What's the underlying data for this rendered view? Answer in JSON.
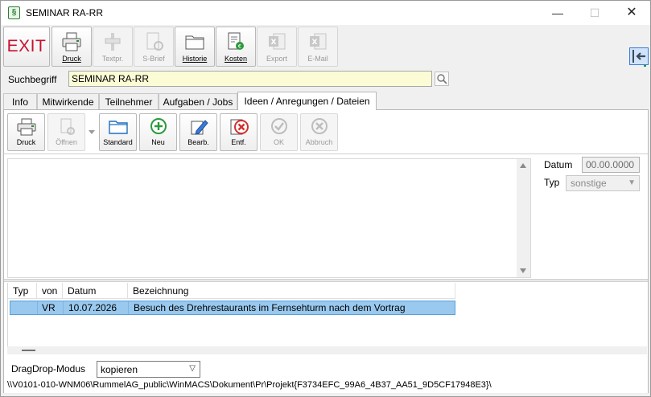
{
  "window": {
    "title": "SEMINAR RA-RR",
    "minimize": "—",
    "maximize": "☐",
    "close": "✕"
  },
  "toolbar": {
    "exit_label": "EXIT",
    "buttons": [
      {
        "label": "Druck",
        "icon": "printer-icon",
        "enabled": true
      },
      {
        "label": "Textpr.",
        "icon": "text-processing-icon",
        "enabled": false
      },
      {
        "label": "S-Brief",
        "icon": "serial-letter-icon",
        "enabled": false
      },
      {
        "label": "Historie",
        "icon": "folder-icon",
        "enabled": true
      },
      {
        "label": "Kosten",
        "icon": "costs-icon",
        "enabled": true
      },
      {
        "label": "Export",
        "icon": "excel-icon",
        "enabled": false
      },
      {
        "label": "E-Mail",
        "icon": "excel-mail-icon",
        "enabled": false
      }
    ]
  },
  "search": {
    "label": "Suchbegriff",
    "value": "SEMINAR RA-RR"
  },
  "tabs": [
    {
      "label": "Info",
      "active": false
    },
    {
      "label": "Mitwirkende",
      "active": false
    },
    {
      "label": "Teilnehmer",
      "active": false
    },
    {
      "label": "Aufgaben / Jobs",
      "active": false
    },
    {
      "label": "Ideen / Anregungen / Dateien",
      "active": true
    }
  ],
  "panel_toolbar": {
    "buttons": [
      {
        "label": "Druck",
        "enabled": true
      },
      {
        "label": "Öffnen",
        "enabled": false
      },
      {
        "label": "Standard",
        "enabled": true
      },
      {
        "label": "Neu",
        "enabled": true
      },
      {
        "label": "Bearb.",
        "enabled": true
      },
      {
        "label": "Entf.",
        "enabled": true
      },
      {
        "label": "OK",
        "enabled": false
      },
      {
        "label": "Abbruch",
        "enabled": false
      }
    ]
  },
  "detail": {
    "datum_label": "Datum",
    "datum_value": "00.00.0000",
    "typ_label": "Typ",
    "typ_value": "sonstige"
  },
  "grid": {
    "columns": [
      "Typ",
      "von",
      "Datum",
      "Bezeichnung"
    ],
    "rows": [
      {
        "typ": "",
        "von": "VR",
        "datum": "10.07.2026",
        "bezeichnung": "Besuch des Drehrestaurants im Fernsehturm nach dem Vortrag"
      }
    ]
  },
  "dragdrop": {
    "label": "DragDrop-Modus",
    "value": "kopieren"
  },
  "path": "\\\\V0101-010-WNM06\\RummelAG_public\\WinMACS\\Dokument\\Pr\\Projekt{F3734EFC_99A6_4B37_AA51_9D5CF17948E3}\\",
  "colors": {
    "exit_red": "#c8102e",
    "search_bg": "#fbfbd6",
    "selection": "#99c9ef",
    "nav_green": "#1a9e3a",
    "nav_blue": "#3b7bd6"
  }
}
